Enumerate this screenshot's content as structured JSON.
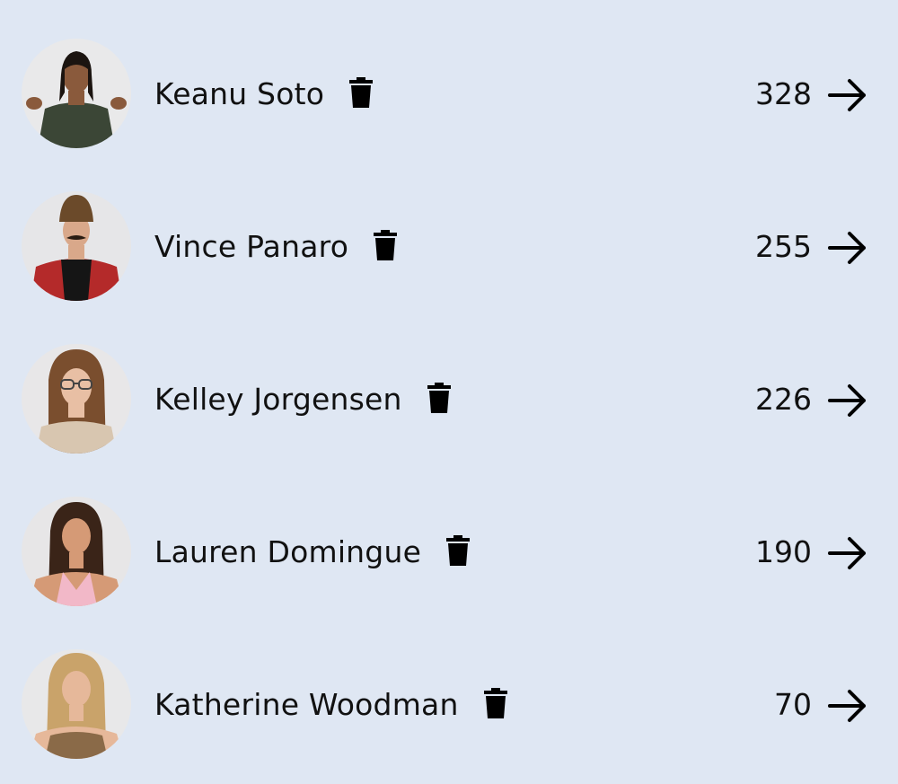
{
  "contestants": [
    {
      "name": "Keanu Soto",
      "count": "328",
      "delete_icon": "trash-icon",
      "open_icon": "arrow-right-icon",
      "skin": "#8a5a3c",
      "hair": "#1b1410",
      "shirt": "#3b4636",
      "bg": "#e9e9ea"
    },
    {
      "name": "Vince Panaro",
      "count": "255",
      "delete_icon": "trash-icon",
      "open_icon": "arrow-right-icon",
      "skin": "#d9a88a",
      "hair": "#6b4a2a",
      "shirt": "#b42a2a",
      "bg": "#e6e6e8"
    },
    {
      "name": "Kelley Jorgensen",
      "count": "226",
      "delete_icon": "trash-icon",
      "open_icon": "arrow-right-icon",
      "skin": "#e8bfa4",
      "hair": "#7a4e2e",
      "shirt": "#d8c6b0",
      "bg": "#e8e7e8"
    },
    {
      "name": "Lauren Domingue",
      "count": "190",
      "delete_icon": "trash-icon",
      "open_icon": "arrow-right-icon",
      "skin": "#d59a76",
      "hair": "#3a2418",
      "shirt": "#f2b8c8",
      "bg": "#e7e6e7"
    },
    {
      "name": "Katherine Woodman",
      "count": "70",
      "delete_icon": "trash-icon",
      "open_icon": "arrow-right-icon",
      "skin": "#e6b89a",
      "hair": "#c9a36a",
      "shirt": "#8a6a48",
      "bg": "#e8e8e9"
    }
  ]
}
